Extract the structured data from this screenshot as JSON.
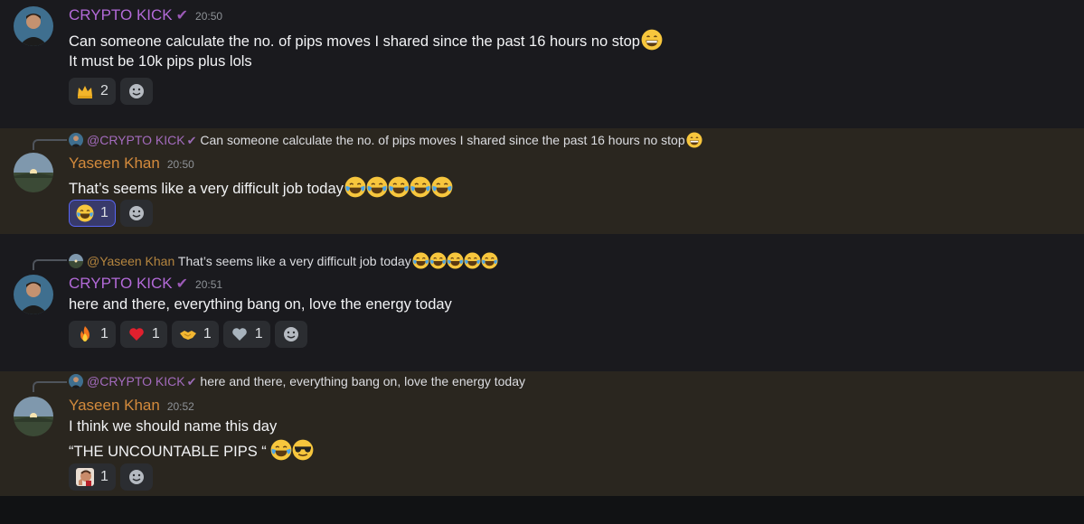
{
  "colors": {
    "bg": "#1a1a1e",
    "highlight": "#2a261f",
    "purple_name": "#b36ad8",
    "orange_name": "#d38a3c"
  },
  "messages": [
    {
      "author": "CRYPTO KICK",
      "verified_icon": "check-icon",
      "time": "20:50",
      "lines": [
        "Can someone calculate the no. of pips moves I shared since the past 16 hours no stop",
        "It must be 10k pips plus lols"
      ],
      "reactions": [
        {
          "emoji": "crown",
          "count": "2"
        }
      ]
    },
    {
      "reply_to": {
        "author": "@CRYPTO KICK",
        "text": "Can someone calculate the no. of pips moves I shared since the past 16 hours no stop"
      },
      "author": "Yaseen Khan",
      "time": "20:50",
      "lines": [
        "That’s seems like a very difficult job today"
      ],
      "reactions": [
        {
          "emoji": "joy",
          "count": "1"
        }
      ]
    },
    {
      "reply_to": {
        "author": "@Yaseen Khan",
        "text": "That’s seems like a very difficult job today"
      },
      "author": "CRYPTO KICK",
      "time": "20:51",
      "lines": [
        "here and there, everything bang on, love the energy today"
      ],
      "reactions": [
        {
          "emoji": "fire",
          "count": "1"
        },
        {
          "emoji": "heart",
          "count": "1"
        },
        {
          "emoji": "handshake",
          "count": "1"
        },
        {
          "emoji": "grey-heart",
          "count": "1"
        }
      ]
    },
    {
      "reply_to": {
        "author": "@CRYPTO KICK",
        "text": "here and there, everything bang on, love the energy today"
      },
      "author": "Yaseen Khan",
      "time": "20:52",
      "lines": [
        "I think we should name this day",
        "“THE UNCOUNTABLE PIPS “"
      ],
      "reactions": [
        {
          "emoji": "custom-face",
          "count": "1"
        }
      ]
    }
  ]
}
